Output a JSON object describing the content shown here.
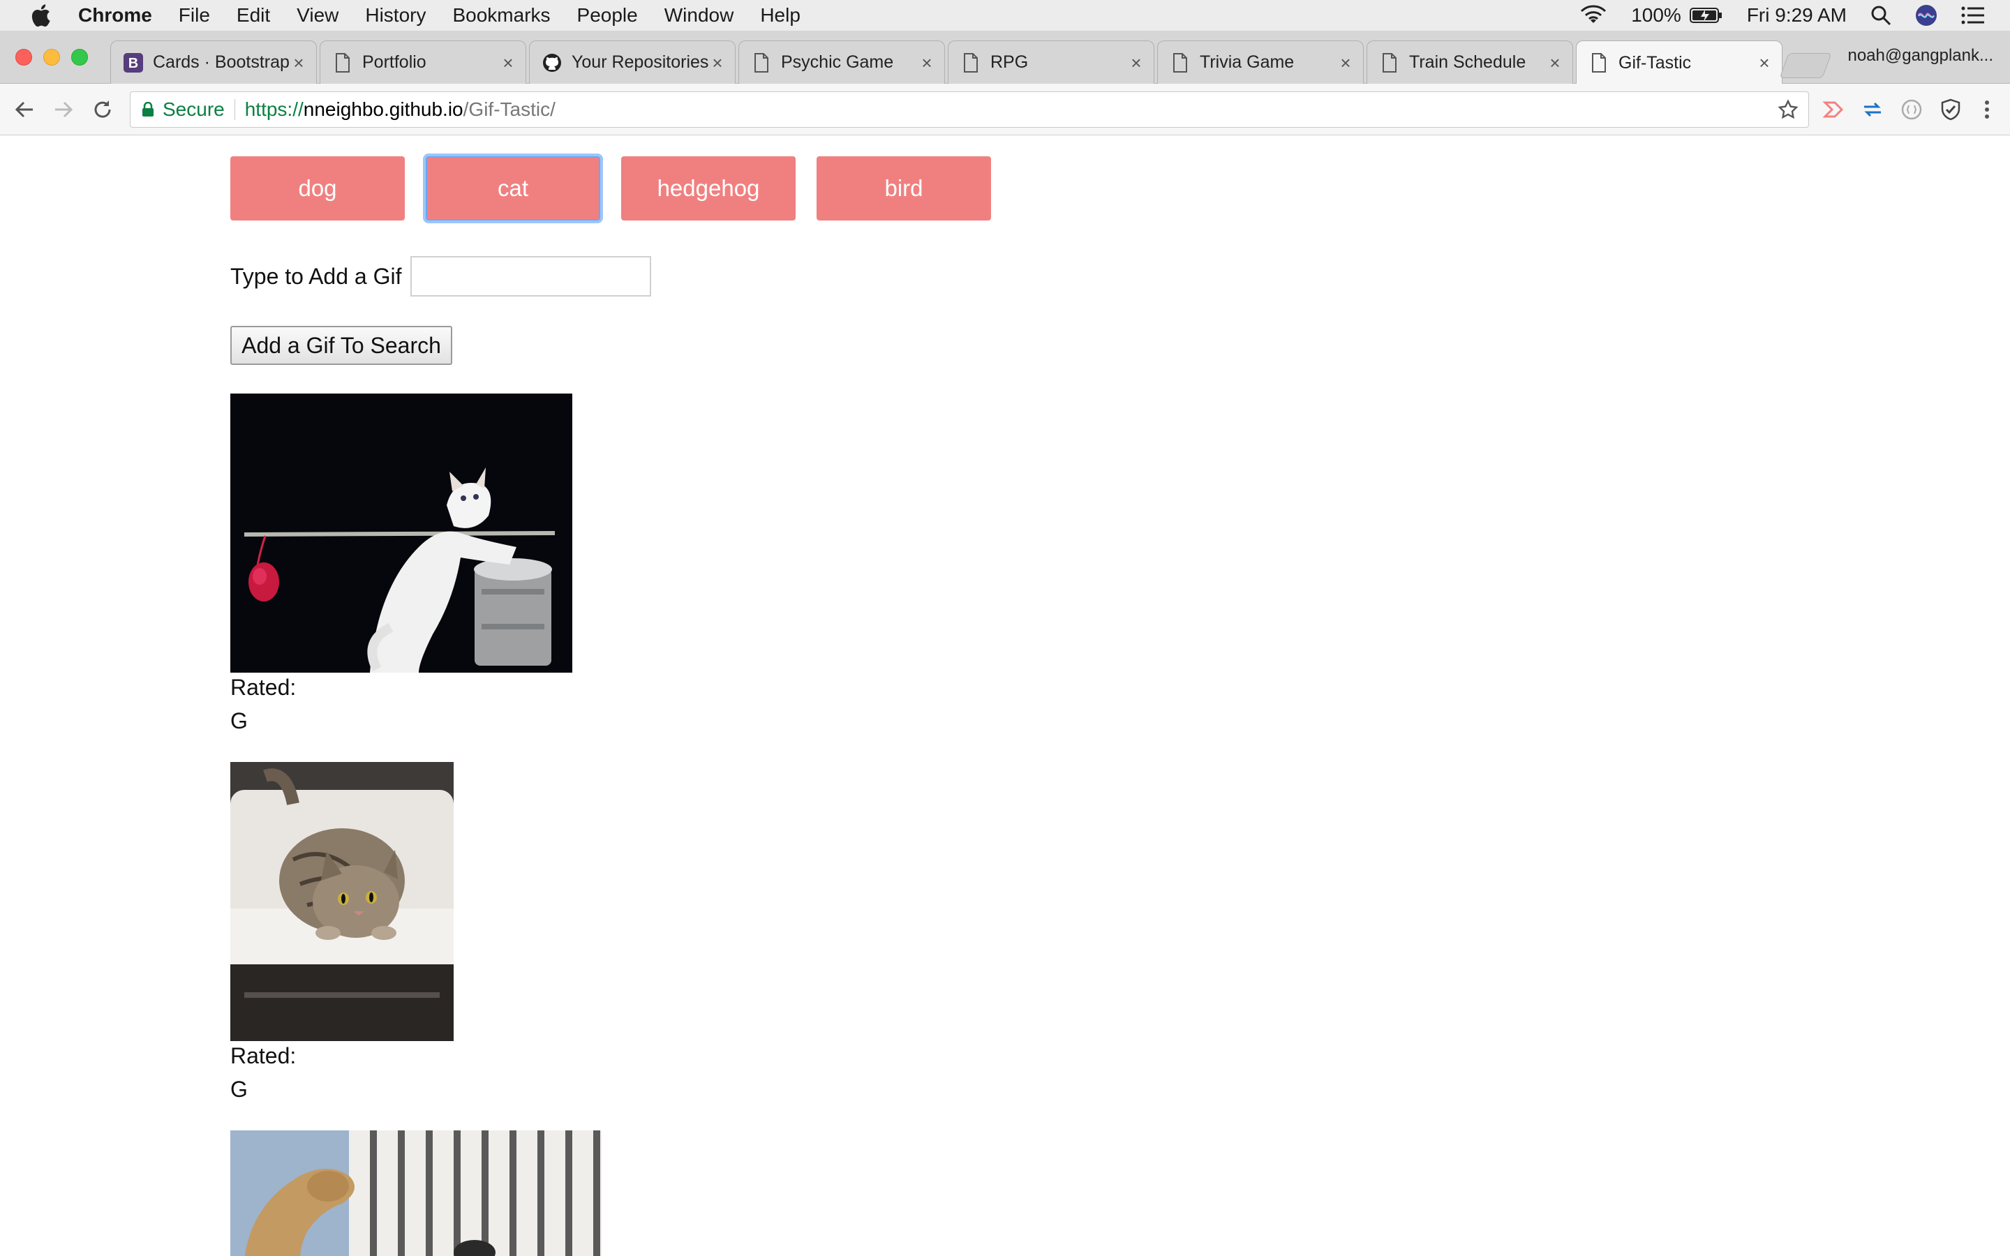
{
  "menubar": {
    "app": "Chrome",
    "items": [
      "File",
      "Edit",
      "View",
      "History",
      "Bookmarks",
      "People",
      "Window",
      "Help"
    ],
    "battery": "100%",
    "clock": "Fri 9:29 AM"
  },
  "tabs": [
    {
      "title": "Cards · Bootstrap",
      "icon": "bootstrap-icon"
    },
    {
      "title": "Portfolio",
      "icon": "page-icon"
    },
    {
      "title": "Your Repositories",
      "icon": "github-icon"
    },
    {
      "title": "Psychic Game",
      "icon": "page-icon"
    },
    {
      "title": "RPG",
      "icon": "page-icon"
    },
    {
      "title": "Trivia Game",
      "icon": "page-icon"
    },
    {
      "title": "Train Schedule",
      "icon": "page-icon"
    },
    {
      "title": "Gif-Tastic",
      "icon": "page-icon",
      "active": true
    }
  ],
  "profile": "noah@gangplank...",
  "address": {
    "secure_label": "Secure",
    "scheme": "https://",
    "host": "nneighbo.github.io",
    "path": "/Gif-Tastic/"
  },
  "page": {
    "topics": [
      "dog",
      "cat",
      "hedgehog",
      "bird"
    ],
    "focused_topic": "cat",
    "add_label": "Type to Add a Gif",
    "add_input_value": "",
    "add_button": "Add a Gif To Search",
    "gifs": [
      {
        "rated_label": "Rated:",
        "rating": "G",
        "subject": "white cat batting at red yarn toy"
      },
      {
        "rated_label": "Rated:",
        "rating": "G",
        "subject": "tabby cat crouching on white bench"
      },
      {
        "subject": "dog jumping near white fence"
      }
    ]
  },
  "colors": {
    "topic_button": "#f08080",
    "secure_green": "#0b8043"
  }
}
